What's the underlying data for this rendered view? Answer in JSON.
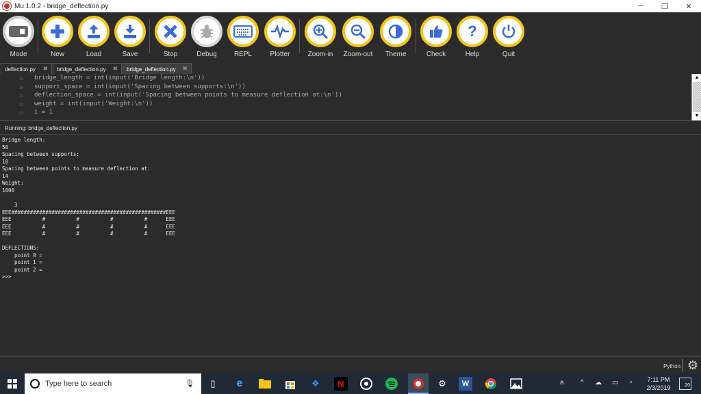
{
  "window": {
    "title": "Mu 1.0.2 - bridge_deflection.py",
    "minimize": "─",
    "maximize": "❐",
    "close": "✕"
  },
  "toolbar": {
    "buttons": [
      {
        "label": "Mode",
        "icon": "mode-icon"
      },
      {
        "label": "New",
        "icon": "plus-icon"
      },
      {
        "label": "Load",
        "icon": "upload-icon"
      },
      {
        "label": "Save",
        "icon": "download-icon"
      },
      {
        "label": "Stop",
        "icon": "x-icon"
      },
      {
        "label": "Debug",
        "icon": "bug-icon"
      },
      {
        "label": "REPL",
        "icon": "keyboard-icon"
      },
      {
        "label": "Plotter",
        "icon": "pulse-icon"
      },
      {
        "label": "Zoom-in",
        "icon": "zoom-in-icon"
      },
      {
        "label": "Zoom-out",
        "icon": "zoom-out-icon"
      },
      {
        "label": "Theme",
        "icon": "theme-icon"
      },
      {
        "label": "Check",
        "icon": "thumbs-up-icon"
      },
      {
        "label": "Help",
        "icon": "question-icon"
      },
      {
        "label": "Quit",
        "icon": "power-icon"
      }
    ]
  },
  "tabs": [
    {
      "label": "deflection.py",
      "close": "✖"
    },
    {
      "label": "bridge_deflection.py",
      "close": "✖"
    },
    {
      "label": "bridge_deflection.py",
      "close": "✖"
    }
  ],
  "editor": {
    "lines": [
      {
        "num": "19",
        "code": "bridge_length = int(input('Bridge length:\\n'))"
      },
      {
        "num": "20",
        "code": "support_space = int(input('Spacing between supports:\\n'))"
      },
      {
        "num": "21",
        "code": "deflection_space = int(input('Spacing between points to measure deflection at:\\n'))"
      },
      {
        "num": "22",
        "code": "weight = int(input('Weight:\\n'))"
      },
      {
        "num": "23",
        "code": "i = 1"
      }
    ]
  },
  "runpane": {
    "title": "Running: bridge_deflection.py",
    "lines": [
      "Bridge length:",
      "50",
      "Spacing between supports:",
      "10",
      "Spacing between points to measure deflection at:",
      "14",
      "Weight:",
      "1000",
      "",
      "    3",
      "EEE##################################################EEE",
      "EEE          #          #          #          #      EEE",
      "EEE          #          #          #          #      EEE",
      "EEE          #          #          #          #      EEE",
      "",
      "DEFLECTIONS:",
      "    point 0 =",
      "    point 1 =",
      "    point 2 =",
      ">>>"
    ]
  },
  "statusbar": {
    "mode": "Python"
  },
  "taskbar": {
    "search_placeholder": "Type here to search",
    "time": "7:11 PM",
    "date": "2/3/2019",
    "notifications": "20"
  }
}
